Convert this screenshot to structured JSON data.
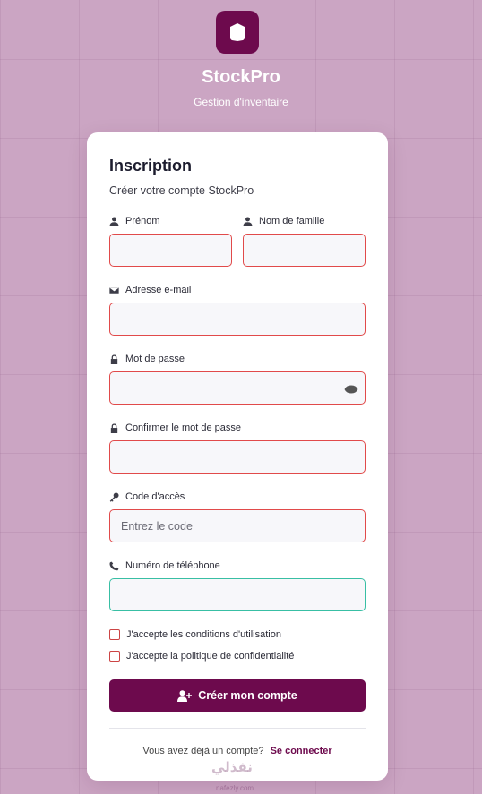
{
  "brand": {
    "title": "StockPro",
    "subtitle": "Gestion d'inventaire",
    "color": "#6d0a4d"
  },
  "form": {
    "title": "Inscription",
    "subtitle": "Créer votre compte StockPro",
    "fields": {
      "first_name": {
        "label": "Prénom",
        "value": "",
        "icon": "user-icon"
      },
      "last_name": {
        "label": "Nom de famille",
        "value": "",
        "icon": "user-icon"
      },
      "email": {
        "label": "Adresse e-mail",
        "value": "",
        "icon": "envelope-icon"
      },
      "password": {
        "label": "Mot de passe",
        "value": "",
        "icon": "lock-icon"
      },
      "confirm_password": {
        "label": "Confirmer le mot de passe",
        "value": "",
        "icon": "lock-icon"
      },
      "access_code": {
        "label": "Code d'accès",
        "placeholder": "Entrez le code",
        "value": "",
        "icon": "key-icon"
      },
      "phone": {
        "label": "Numéro de téléphone",
        "value": "",
        "icon": "phone-icon"
      }
    },
    "checkboxes": {
      "terms": "J'accepte les conditions d'utilisation",
      "privacy": "J'accepte la politique de confidentialité"
    },
    "submit_label": "Créer mon compte",
    "footer_text": "Vous avez déjà un compte?",
    "login_link": "Se connecter"
  },
  "watermark": {
    "text": "نفذلي",
    "url": "nafezly.com"
  },
  "colors": {
    "error_border": "#e14a4a",
    "valid_border": "#38bfa4",
    "background": "#cba5c3"
  }
}
